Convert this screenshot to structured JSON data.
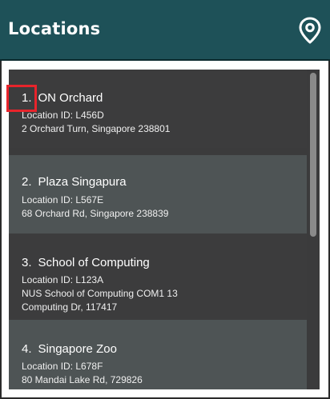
{
  "header": {
    "title": "Locations",
    "icon": "map-pin-icon"
  },
  "locations": [
    {
      "index": "1.",
      "name": "ON Orchard",
      "id_line": "Location ID: L456D",
      "address_lines": [
        "2 Orchard Turn, Singapore 238801"
      ]
    },
    {
      "index": "2.",
      "name": "Plaza Singapura",
      "id_line": "Location ID: L567E",
      "address_lines": [
        "68 Orchard Rd, Singapore 238839"
      ]
    },
    {
      "index": "3.",
      "name": "School of Computing",
      "id_line": "Location ID: L123A",
      "address_lines": [
        "NUS School of Computing COM1 13",
        "Computing Dr, 117417"
      ]
    },
    {
      "index": "4.",
      "name": "Singapore Zoo",
      "id_line": "Location ID: L678F",
      "address_lines": [
        "80 Mandai Lake Rd, 729826"
      ]
    }
  ],
  "colors": {
    "header_bg": "#1e5158",
    "item_dark": "#3c3c3d",
    "item_light": "#4e5455",
    "highlight": "#e8242b"
  }
}
